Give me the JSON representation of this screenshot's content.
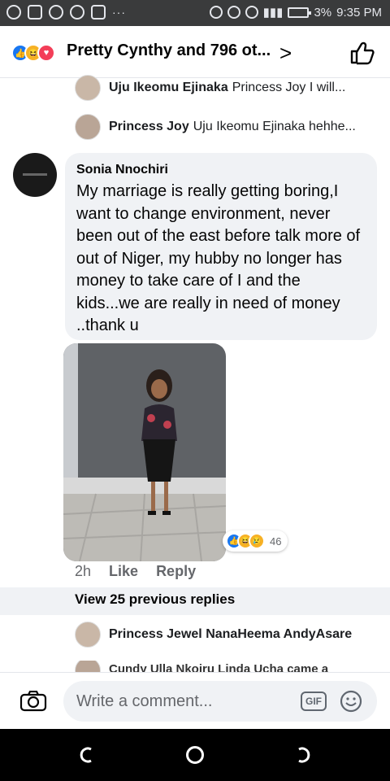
{
  "status_bar": {
    "battery": "3%",
    "time": "9:35 PM",
    "dots": "···"
  },
  "header": {
    "title": "Pretty Cynthy and 796 ot...",
    "reaction_icons": [
      "like-icon",
      "haha-icon",
      "love-icon"
    ],
    "chevron": ">"
  },
  "replies_top": [
    {
      "name": "Uju Ikeomu Ejinaka",
      "text": "Princess Joy I will..."
    },
    {
      "name": "Princess Joy",
      "text": "Uju Ikeomu Ejinaka hehhe..."
    }
  ],
  "comment": {
    "author": "Sonia Nnochiri",
    "text": "My marriage is really getting boring,I want to change environment, never been out of the east before talk more of out of Niger, my hubby no longer has money to take care of I and the kids...we are really in need of money ..thank u",
    "reaction_count": "46",
    "time": "2h",
    "like_label": "Like",
    "reply_label": "Reply"
  },
  "view_previous": "View 25 previous replies",
  "replies_bottom": [
    {
      "name": "Princess Jewel NanaHeema AndyAsare",
      "text": ""
    },
    {
      "name": "Cundy Ulla Nkoiru Linda Ucha came a",
      "text": ""
    }
  ],
  "composer": {
    "placeholder": "Write a comment...",
    "gif_label": "GIF"
  },
  "colors": {
    "accent": "#1877f2",
    "bubble": "#f0f2f5",
    "secondary_text": "#65676b"
  }
}
